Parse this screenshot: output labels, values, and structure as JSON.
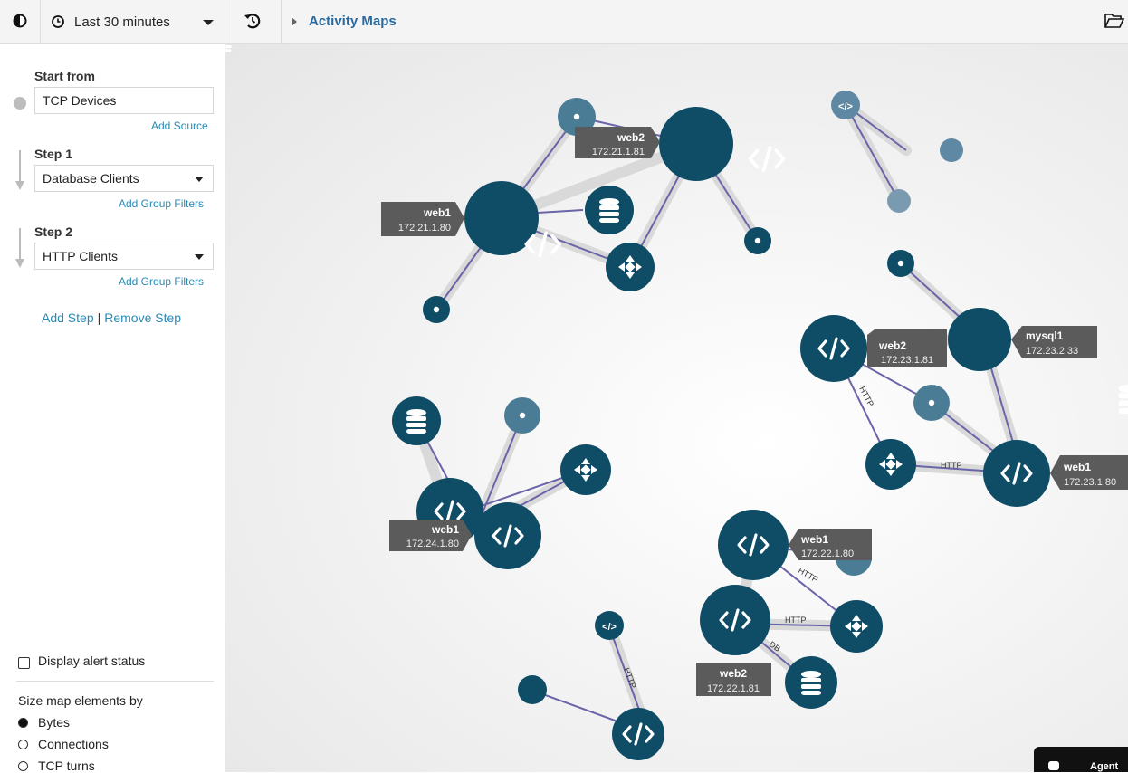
{
  "toolbar": {
    "time_range": "Last 30 minutes",
    "breadcrumb": "Activity Maps"
  },
  "sidebar": {
    "start_from_label": "Start from",
    "source_value": "TCP Devices",
    "add_source": "Add Source",
    "step1_label": "Step 1",
    "step1_value": "Database Clients",
    "step2_label": "Step 2",
    "step2_value": "HTTP Clients",
    "add_group_filters": "Add Group Filters",
    "add_step": "Add Step",
    "remove_step": "Remove Step",
    "step_separator": "|",
    "display_alert_status": "Display alert status",
    "size_by_label": "Size map elements by",
    "size_options": [
      {
        "label": "Bytes",
        "selected": true
      },
      {
        "label": "Connections",
        "selected": false
      },
      {
        "label": "TCP turns",
        "selected": false
      }
    ]
  },
  "map": {
    "node_color": "#0f4c66",
    "peer_color": "#4a7c96",
    "edge_color": "#6a64a8",
    "labels": [
      {
        "name": "web2",
        "ip": "172.21.1.81"
      },
      {
        "name": "web1",
        "ip": "172.21.1.80"
      },
      {
        "name": "web2",
        "ip": "172.23.1.81"
      },
      {
        "name": "mysql1",
        "ip": "172.23.2.33"
      },
      {
        "name": "web1",
        "ip": "172.23.1.80"
      },
      {
        "name": "web1",
        "ip": "172.24.1.80"
      },
      {
        "name": "web1",
        "ip": "172.22.1.80"
      },
      {
        "name": "web2",
        "ip": "172.22.1.81"
      }
    ],
    "edge_labels": [
      "HTTP",
      "HTTP",
      "HTTP",
      "HTTP",
      "DB",
      "HTTP"
    ]
  },
  "agent_tab": "Agent"
}
